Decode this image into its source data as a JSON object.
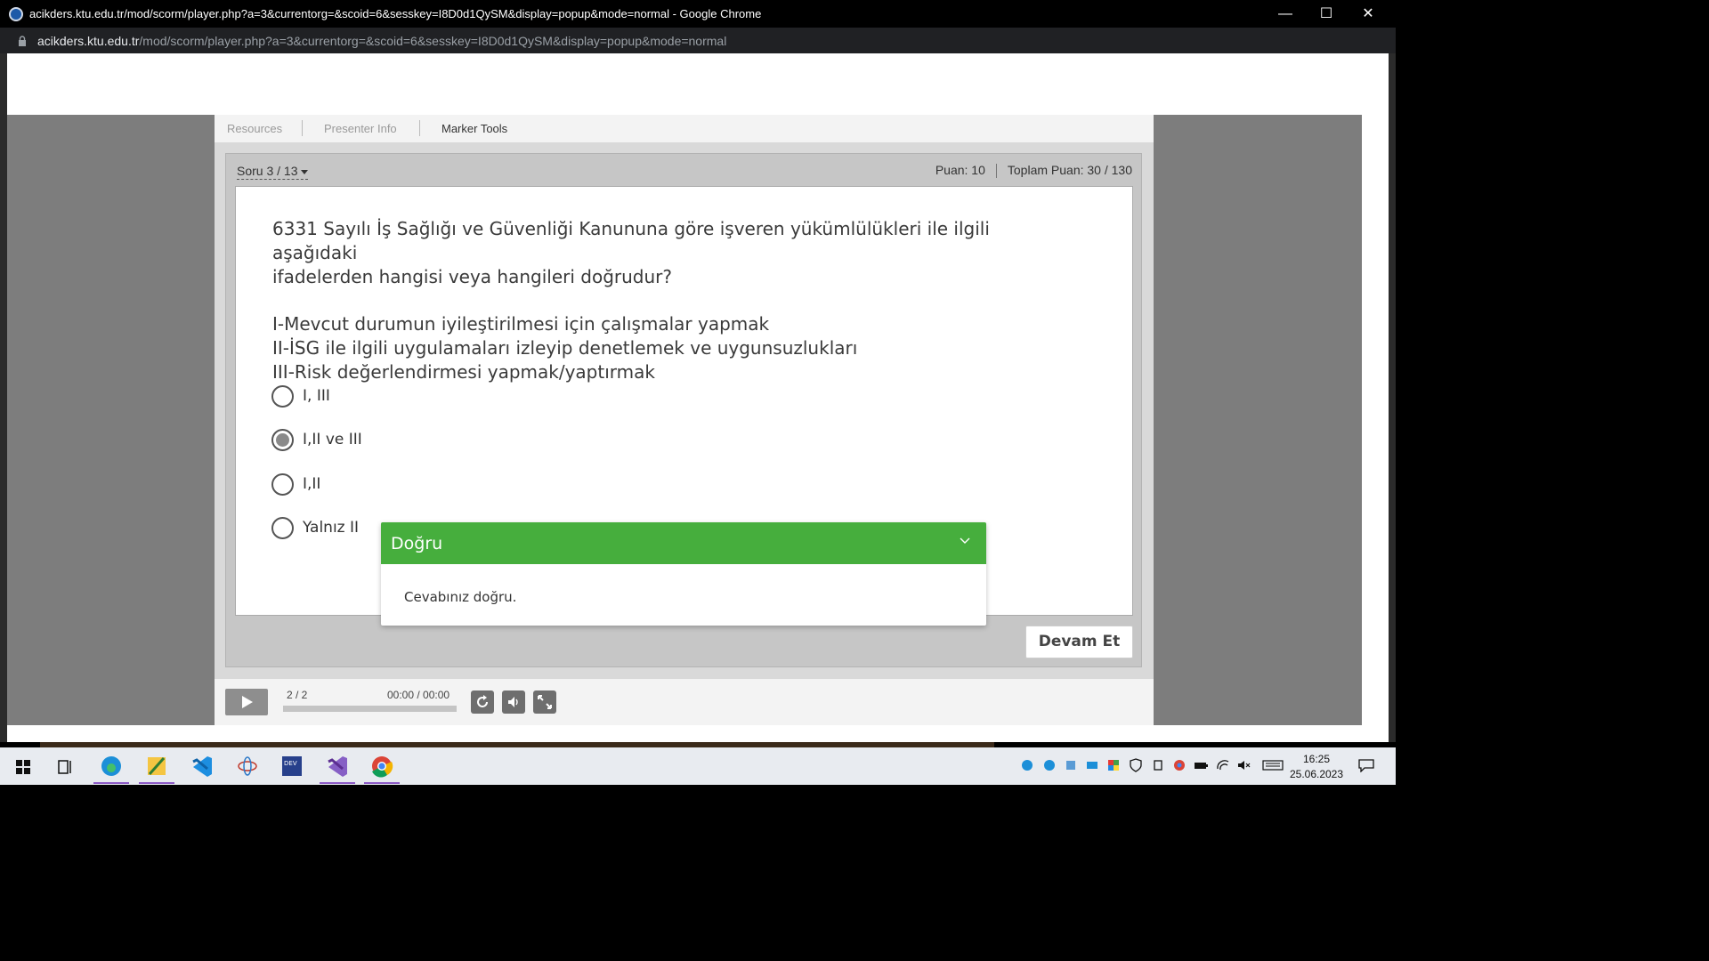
{
  "window": {
    "title": "acikders.ktu.edu.tr/mod/scorm/player.php?a=3&currentorg=&scoid=6&sesskey=I8D0d1QySM&display=popup&mode=normal - Google Chrome",
    "url_host": "acikders.ktu.edu.tr",
    "url_path": "/mod/scorm/player.php?a=3&currentorg=&scoid=6&sesskey=I8D0d1QySM&display=popup&mode=normal"
  },
  "tabs": [
    {
      "label": "Resources"
    },
    {
      "label": "Presenter Info"
    },
    {
      "label": "Marker Tools"
    }
  ],
  "quiz": {
    "nav_label": "Soru 3 / 13",
    "points": "Puan: 10",
    "total_points": "Toplam Puan: 30 / 130",
    "question_line1": "6331 Sayılı İş Sağlığı ve Güvenliği Kanununa göre işveren yükümlülükleri ile ilgili aşağıdaki",
    "question_line2": "ifadelerden hangisi veya hangileri doğrudur?",
    "statement1": "I-Mevcut durumun iyileştirilmesi için çalışmalar yapmak",
    "statement2": "II-İSG ile ilgili uygulamaları izleyip denetlemek ve uygunsuzlukları",
    "statement3": "III-Risk değerlendirmesi yapmak/yaptırmak",
    "options": [
      {
        "label": "I, III",
        "selected": false
      },
      {
        "label": "I,II ve III",
        "selected": true
      },
      {
        "label": "I,II",
        "selected": false
      },
      {
        "label": "Yalnız II",
        "selected": false
      }
    ],
    "continue_label": "Devam Et"
  },
  "feedback": {
    "title": "Doğru",
    "message": "Cevabınız doğru.",
    "color": "#46ae3d"
  },
  "player": {
    "slide_counter": "2 / 2",
    "time": "00:00 / 00:00",
    "controls": [
      "play-icon",
      "replay-icon",
      "volume-icon",
      "fullscreen-icon"
    ]
  },
  "taskbar": {
    "time": "16:25",
    "date": "25.06.2023",
    "apps": [
      "windows-start-icon",
      "task-view-icon",
      "edge-icon",
      "app-icon",
      "vscode-icon",
      "app-icon",
      "devc-icon",
      "visual-studio-icon",
      "chrome-icon"
    ]
  }
}
